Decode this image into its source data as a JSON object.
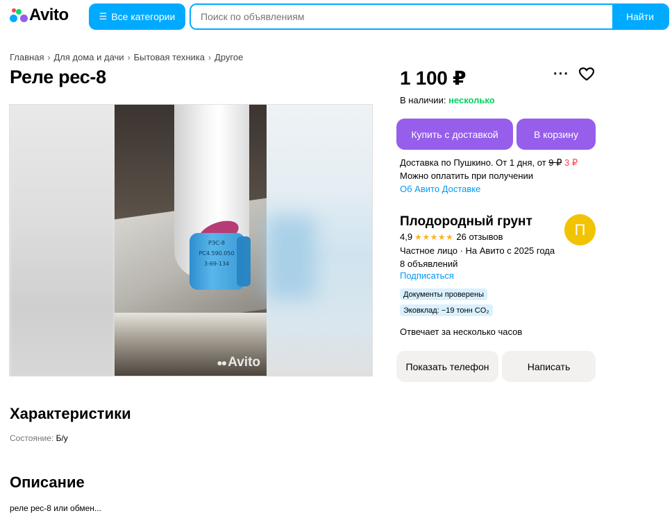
{
  "header": {
    "logo_text": "Avito",
    "categories_button": "Все категории",
    "search_placeholder": "Поиск по объявлениям",
    "search_button": "Найти"
  },
  "breadcrumb": [
    "Главная",
    "Для дома и дачи",
    "Бытовая техника",
    "Другое"
  ],
  "listing": {
    "title": "Реле рес-8",
    "price": "1 100 ₽",
    "stock_label": "В наличии:",
    "stock_value": "несколько",
    "buy_button": "Купить с доставкой",
    "cart_button": "В корзину",
    "delivery_line_prefix": "Доставка по Пушкино. От 1 дня, от",
    "delivery_old_price": "9 ₽",
    "delivery_new_price": "3 ₽",
    "pay_on_receipt": "Можно оплатить при получении",
    "delivery_link": "Об Авито Доставке"
  },
  "photo": {
    "relay_lines": [
      "РЭС-8",
      "РС4.590.050",
      "3-69-134"
    ],
    "watermark": "Avito"
  },
  "seller": {
    "name": "Плодородный грунт",
    "avatar_letter": "П",
    "rating": "4,9",
    "stars": "★★★★★",
    "reviews": "26 отзывов",
    "info_line1": "Частное лицо · На Авито с 2025 года",
    "info_line2": "8 объявлений",
    "subscribe": "Подписаться",
    "badge_docs": "Документы проверены",
    "badge_eco": "Эковклад: −19 тонн CO₂",
    "response_time": "Отвечает за несколько часов",
    "phone_button": "Показать телефон",
    "write_button": "Написать"
  },
  "characteristics": {
    "heading": "Характеристики",
    "condition_label": "Состояние:",
    "condition_value": "Б/у"
  },
  "description": {
    "heading": "Описание",
    "text": "реле рес-8 или обмен..."
  },
  "colors": {
    "brand_blue": "#00aaff",
    "purple": "#965eeb",
    "green": "#02d15c",
    "avatar": "#f2c300"
  }
}
